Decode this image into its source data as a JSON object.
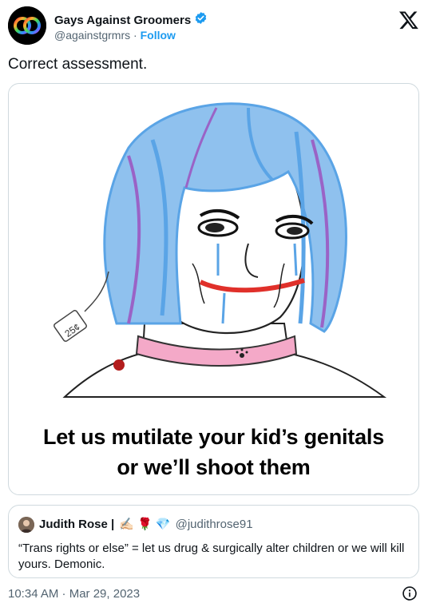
{
  "author": {
    "display_name": "Gays Against Groomers",
    "handle": "@againstgrmrs",
    "separator": " · ",
    "follow_label": "Follow"
  },
  "tweet": {
    "text": "Correct assessment."
  },
  "media": {
    "caption_line1": "Let us mutilate your kid’s genitals",
    "caption_line2": "or we’ll shoot them",
    "tag_text": "25¢"
  },
  "quote": {
    "name": "Judith Rose |",
    "emojis": "✍🏻 🌹 💎",
    "handle": "@judithrose91",
    "text": "“Trans rights or else” = let us drug & surgically alter children or we will kill yours. Demonic."
  },
  "timestamp": "10:34 AM · Mar 29, 2023",
  "colors": {
    "link": "#1d9bf0",
    "secondary_text": "#536471",
    "border": "#cfd9de",
    "hair_blue": "#5aa4e6",
    "hair_purple": "#9a63c6",
    "collar_pink": "#f4a9c8",
    "lips_red": "#e0302a"
  },
  "icons": {
    "verified": "verified-badge-icon",
    "x": "x-logo-icon",
    "info": "info-icon"
  }
}
